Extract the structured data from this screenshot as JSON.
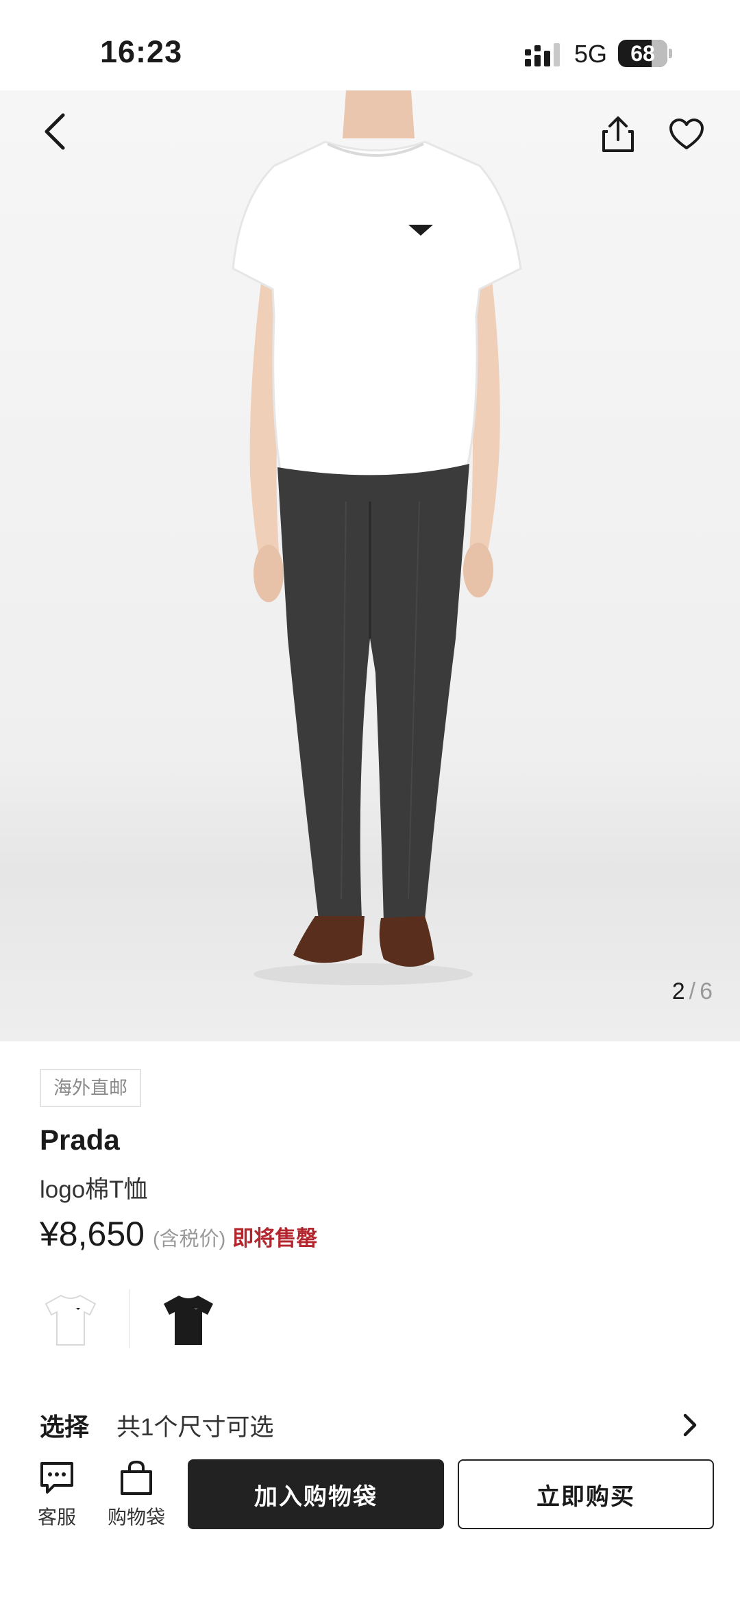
{
  "status_bar": {
    "time": "16:23",
    "network": "5G",
    "battery": "68",
    "battery_level": 0.68
  },
  "gallery": {
    "current": "2",
    "total": "6",
    "separator": "/"
  },
  "product": {
    "tag": "海外直邮",
    "brand": "Prada",
    "name": "logo棉T恤",
    "price": "¥8,650",
    "tax_note": "(含税价)",
    "stock_note": "即将售罄",
    "color_swatches": [
      {
        "name": "white-tshirt-swatch",
        "color": "#ffffff"
      },
      {
        "name": "black-tshirt-swatch",
        "color": "#1b1b1b"
      }
    ]
  },
  "size_select": {
    "label": "选择",
    "value": "共1个尺寸可选"
  },
  "bottom_bar": {
    "customer_service": "客服",
    "shopping_bag": "购物袋",
    "add_to_bag": "加入购物袋",
    "buy_now": "立即购买"
  },
  "colors": {
    "accent_red": "#b3262d",
    "primary_dark": "#222222"
  },
  "icons": [
    "back-icon",
    "share-icon",
    "heart-icon",
    "chat-icon",
    "bag-icon",
    "chevron-right-icon"
  ]
}
